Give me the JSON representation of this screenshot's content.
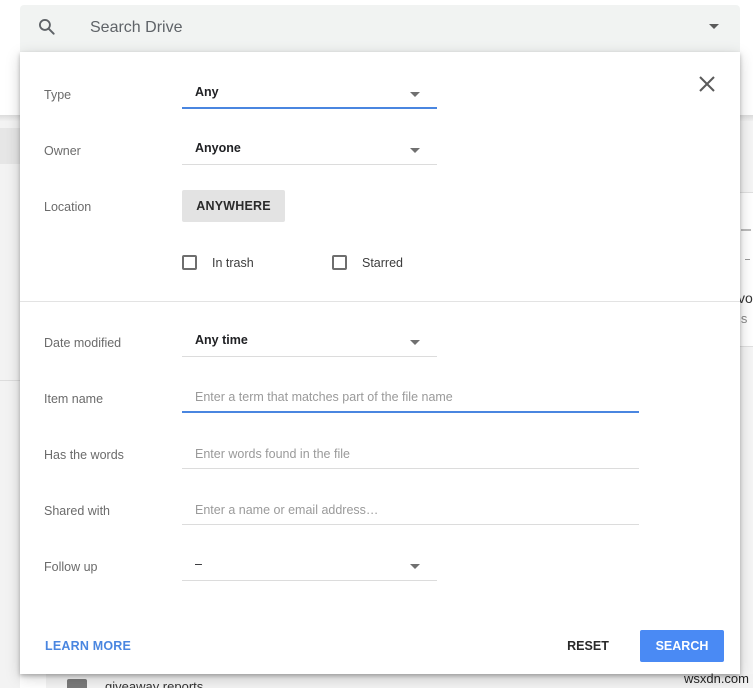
{
  "search_bar": {
    "placeholder": "Search Drive",
    "icon": "search-icon",
    "dropdown_icon": "caret-down-icon"
  },
  "panel": {
    "close_icon": "close-icon",
    "type": {
      "label": "Type",
      "value": "Any"
    },
    "owner": {
      "label": "Owner",
      "value": "Anyone"
    },
    "location": {
      "label": "Location",
      "value": "ANYWHERE"
    },
    "checkboxes": [
      {
        "label": "In trash",
        "checked": false
      },
      {
        "label": "Starred",
        "checked": false
      }
    ],
    "date_modified": {
      "label": "Date modified",
      "value": "Any time"
    },
    "item_name": {
      "label": "Item name",
      "value": "",
      "placeholder": "Enter a term that matches part of the file name"
    },
    "has_words": {
      "label": "Has the words",
      "value": "",
      "placeholder": "Enter words found in the file"
    },
    "shared_with": {
      "label": "Shared with",
      "value": "",
      "placeholder": "Enter a name or email address…"
    },
    "follow_up": {
      "label": "Follow up",
      "value": "–"
    },
    "footer": {
      "learn_more": "LEARN MORE",
      "reset": "RESET",
      "search": "SEARCH"
    }
  },
  "background": {
    "folder_name": "giveaway reports",
    "right_text_1": "vo",
    "right_text_2": "is"
  },
  "watermark": "wsxdn.com",
  "colors": {
    "accent": "#4a86e0",
    "search_button": "#4a8af4",
    "search_bar_bg": "#f1f3f2"
  }
}
